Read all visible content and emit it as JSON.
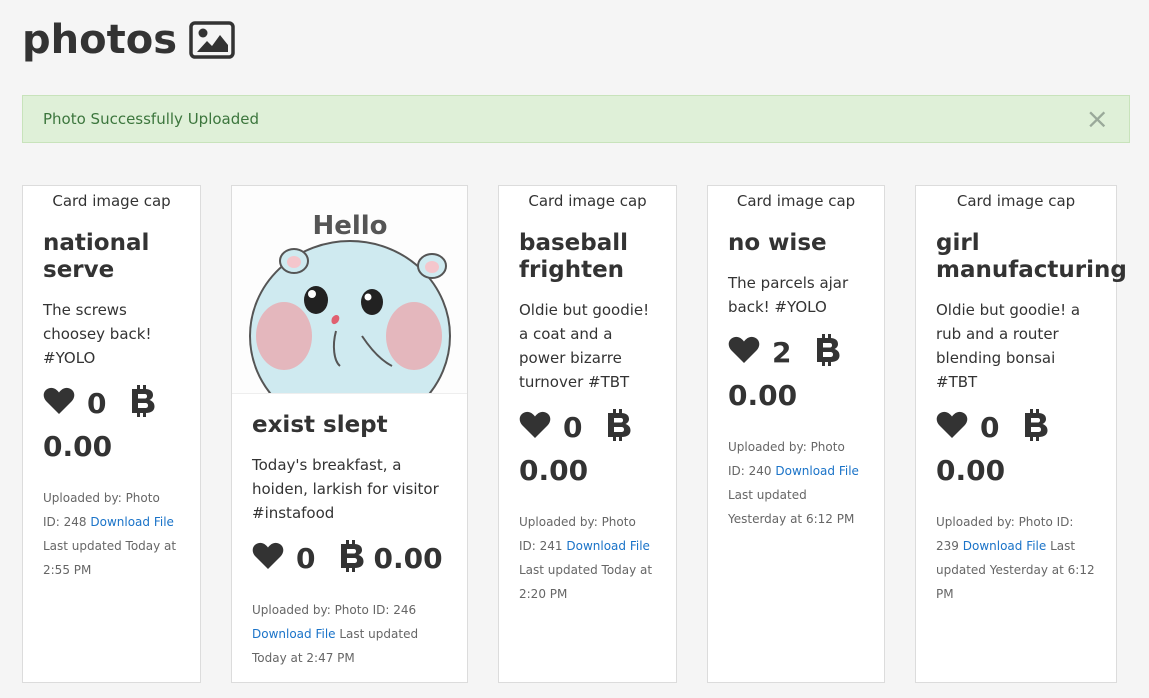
{
  "page": {
    "title": "photos",
    "title_icon": "image-icon"
  },
  "alert": {
    "message": "Photo Successfully Uploaded",
    "close_label": "×"
  },
  "cards": [
    {
      "cap": "Card image cap",
      "title": "national serve",
      "text": "The screws choosey back! #YOLO",
      "likes": "0",
      "price": "0.00",
      "meta_prefix": "Uploaded by: Photo ID: 248",
      "download": "Download File",
      "meta_suffix": "Last updated Today at 2:55 PM"
    },
    {
      "image_text": "Hello",
      "title": "exist slept",
      "text": "Today's breakfast, a hoiden, larkish for visitor #instafood",
      "likes": "0",
      "price": "0.00",
      "meta_prefix": "Uploaded by: Photo ID: 246",
      "download": "Download File",
      "meta_suffix": "Last updated Today at 2:47 PM"
    },
    {
      "cap": "Card image cap",
      "title": "baseball frighten",
      "text": "Oldie but goodie! a coat and a power bizarre turnover #TBT",
      "likes": "0",
      "price": "0.00",
      "meta_prefix": "Uploaded by: Photo ID: 241",
      "download": "Download File",
      "meta_suffix": "Last updated Today at 2:20 PM"
    },
    {
      "cap": "Card image cap",
      "title": "no wise",
      "text": "The parcels ajar back! #YOLO",
      "likes": "2",
      "price": "0.00",
      "meta_prefix": "Uploaded by: Photo ID: 240",
      "download": "Download File",
      "meta_suffix": "Last updated Yesterday at 6:12 PM"
    },
    {
      "cap": "Card image cap",
      "title": "girl manufacturing",
      "text": "Oldie but goodie! a rub and a router blending bonsai #TBT",
      "likes": "0",
      "price": "0.00",
      "meta_prefix": "Uploaded by: Photo ID: 239",
      "download": "Download File",
      "meta_suffix": "Last updated Yesterday at 6:12 PM"
    }
  ]
}
